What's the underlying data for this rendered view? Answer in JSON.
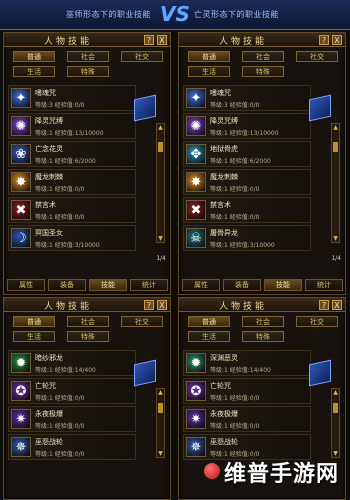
{
  "banner": {
    "left": "巫师形态下的职业技能",
    "vs": "VS",
    "right": "亡灵形态下的职业技能"
  },
  "panel_title": "人物技能",
  "header_buttons": {
    "help": "?",
    "close": "X"
  },
  "tabs": [
    "普通",
    "社会",
    "社交",
    "生活",
    "特殊"
  ],
  "bottom_tabs": [
    "属性",
    "装备",
    "技能",
    "统计"
  ],
  "page_indicator": "1/4",
  "panels": [
    {
      "skills": [
        {
          "name": "嗜魂咒",
          "sub": "等级:3 经验值:0/0",
          "icon": "✦",
          "color": "#3b6fd6"
        },
        {
          "name": "降灵咒缚",
          "sub": "等级:1 经验值:13/10000",
          "icon": "✺",
          "color": "#7a3fc8"
        },
        {
          "name": "亡念花灵",
          "sub": "等级:1 经验值:6/2000",
          "icon": "❀",
          "color": "#3c58b0"
        },
        {
          "name": "魔龙刺棘",
          "sub": "等级:1 经验值:0/0",
          "icon": "✸",
          "color": "#d98a20"
        },
        {
          "name": "禁言术",
          "sub": "等级:1 经验值:0/0",
          "icon": "✖",
          "color": "#8a1f1f"
        },
        {
          "name": "冥国圣女",
          "sub": "等级:1 经验值:3/10000",
          "icon": "☽",
          "color": "#2a56b4"
        }
      ]
    },
    {
      "skills": [
        {
          "name": "嗜魂咒",
          "sub": "等级:3 经验值:0/0",
          "icon": "✦",
          "color": "#3b6fd6"
        },
        {
          "name": "降灵咒缚",
          "sub": "等级:1 经验值:13/10000",
          "icon": "✺",
          "color": "#7a3fc8"
        },
        {
          "name": "地狱骨虎",
          "sub": "等级:1 经验值:6/2000",
          "icon": "✥",
          "color": "#2f8fb0"
        },
        {
          "name": "魔龙刺棘",
          "sub": "等级:1 经验值:0/0",
          "icon": "✸",
          "color": "#d98a20"
        },
        {
          "name": "禁言术",
          "sub": "等级:1 经验值:0/0",
          "icon": "✖",
          "color": "#8a1f1f"
        },
        {
          "name": "屠骨异龙",
          "sub": "等级:1 经验值:3/10000",
          "icon": "☠",
          "color": "#1f6f7a"
        }
      ]
    },
    {
      "skills": [
        {
          "name": "暗纱邪龙",
          "sub": "等级:1 经验值:14/400",
          "icon": "✹",
          "color": "#2a8a3a"
        },
        {
          "name": "亡轮咒",
          "sub": "等级:1 经验值:0/0",
          "icon": "✪",
          "color": "#6a2fa8"
        },
        {
          "name": "永夜极爆",
          "sub": "等级:1 经验值:0/0",
          "icon": "✷",
          "color": "#5a2fa0"
        },
        {
          "name": "巫怨战轮",
          "sub": "等级:1 经验值:0/0",
          "icon": "✵",
          "color": "#3456a8"
        }
      ]
    },
    {
      "skills": [
        {
          "name": "深渊恶灵",
          "sub": "等级:1 经验值:14/400",
          "icon": "✹",
          "color": "#2a8a6a"
        },
        {
          "name": "亡轮咒",
          "sub": "等级:1 经验值:0/0",
          "icon": "✪",
          "color": "#6a2fa8"
        },
        {
          "name": "永夜极爆",
          "sub": "等级:1 经验值:0/0",
          "icon": "✷",
          "color": "#5a2fa0"
        },
        {
          "name": "巫怨战轮",
          "sub": "等级:1 经验值:0/0",
          "icon": "✵",
          "color": "#3456a8"
        }
      ]
    }
  ],
  "watermark": "维普手游网"
}
